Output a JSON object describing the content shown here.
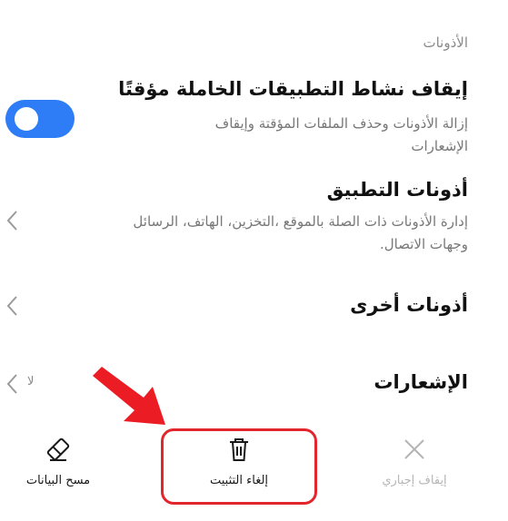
{
  "section": {
    "header": "الأذونات"
  },
  "rows": {
    "pause_activity": {
      "title": "إيقاف نشاط التطبيقات الخاملة مؤقتًا",
      "desc_line1": "إزالة الأذونات وحذف الملفات المؤقتة وإيقاف",
      "desc_line2": "الإشعارات"
    },
    "app_permissions": {
      "title": "أذونات التطبيق",
      "desc_line1": "إدارة الأذونات ذات الصلة بالموقع ،التخزين، الهاتف، الرسائل",
      "desc_line2": "وجهات الاتصال."
    },
    "other_permissions": {
      "title": "أذونات أخرى"
    },
    "notifications": {
      "title": "الإشعارات",
      "value": "لا"
    }
  },
  "bottom_bar": {
    "clear_data": "مسح البيانات",
    "uninstall": "إلغاء التثبيت",
    "force_stop": "إيقاف إجباري"
  },
  "colors": {
    "toggle_on": "#2f7df6",
    "highlight": "#e3262d",
    "disabled": "#b5b5b5"
  },
  "icons": {
    "clear_data": "eraser-icon",
    "uninstall": "trash-icon",
    "force_stop": "close-icon",
    "chevron": "chevron-left-icon",
    "annotation": "red-arrow"
  }
}
